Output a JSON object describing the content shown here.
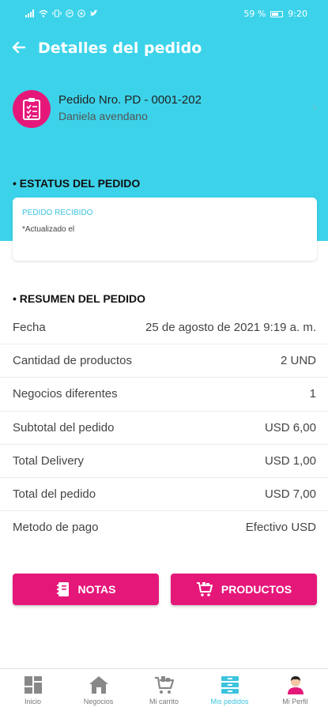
{
  "status_bar": {
    "battery": "59 %",
    "time": "9:20"
  },
  "header": {
    "title": "Detalles del pedido"
  },
  "order": {
    "title": "Pedido Nro. PD - 0001-202",
    "customer": "Daniela avendano"
  },
  "status": {
    "section_title": "• ESTATUS DEL PEDIDO",
    "name": "PEDIDO RECIBIDO",
    "updated": "*Actualizado el"
  },
  "summary": {
    "section_title": "• RESUMEN DEL PEDIDO",
    "rows": [
      {
        "label": "Fecha",
        "value": "25 de agosto de 2021 9:19 a. m."
      },
      {
        "label": "Cantidad de productos",
        "value": "2 UND"
      },
      {
        "label": "Negocios diferentes",
        "value": "1"
      },
      {
        "label": "Subtotal del pedido",
        "value": "USD 6,00"
      },
      {
        "label": "Total Delivery",
        "value": "USD 1,00"
      },
      {
        "label": "Total del pedido",
        "value": "USD 7,00"
      },
      {
        "label": "Metodo de pago",
        "value": "Efectivo USD"
      }
    ]
  },
  "actions": {
    "notas_label": "NOTAS",
    "productos_label": "PRODUCTOS"
  },
  "nav": {
    "items": [
      {
        "label": "Inicio",
        "icon": "grid-icon"
      },
      {
        "label": "Negocios",
        "icon": "store-icon"
      },
      {
        "label": "Mi carrito",
        "icon": "cart-icon"
      },
      {
        "label": "Mis pedidos",
        "icon": "orders-icon",
        "active": true
      },
      {
        "label": "Mi Perfil",
        "icon": "profile-icon"
      }
    ]
  },
  "colors": {
    "primary_cyan": "#3cd3ea",
    "accent_pink": "#e5187a"
  }
}
